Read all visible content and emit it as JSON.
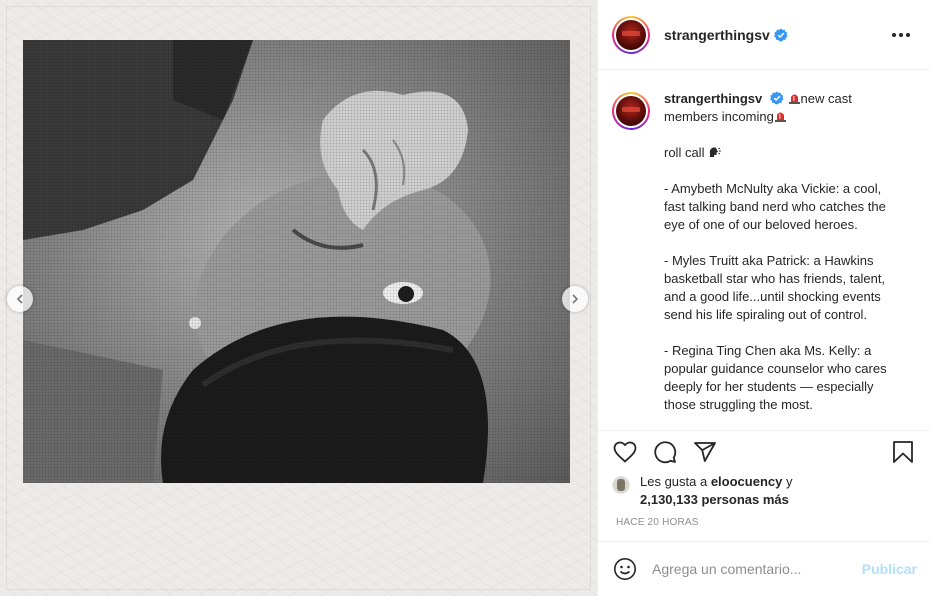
{
  "post": {
    "username": "strangerthingsv",
    "verified": true
  },
  "caption": {
    "username": "strangerthingsv",
    "lines": [
      "new cast members incoming",
      "roll call",
      "- Amybeth McNulty aka Vickie: a cool, fast talking band nerd who catches the eye of one of our beloved heroes.",
      "- Myles Truitt aka Patrick: a Hawkins basketball star who has friends, talent, and a good life...until shocking events send his life spiraling out of control.",
      "- Regina Ting Chen aka Ms. Kelly: a popular guidance counselor who cares deeply for her students — especially those struggling the most."
    ]
  },
  "likes": {
    "prefix": "Les gusta a ",
    "user": "eloocuency",
    "conj": " y",
    "count": "2,130,133 personas más"
  },
  "timestamp": "HACE 20 HORAS",
  "comment": {
    "placeholder": "Agrega un comentario...",
    "publish": "Publicar"
  },
  "colors": {
    "verified_blue": "#3897f0",
    "publish_disabled": "#b2dffc",
    "alarm_red": "#d9302c"
  },
  "icons": [
    "verified-icon",
    "more-options-icon",
    "heart-icon",
    "comment-icon",
    "share-icon",
    "bookmark-icon",
    "smile-icon",
    "chevron-left-icon",
    "chevron-right-icon",
    "police-light-icon",
    "speaking-head-icon"
  ]
}
